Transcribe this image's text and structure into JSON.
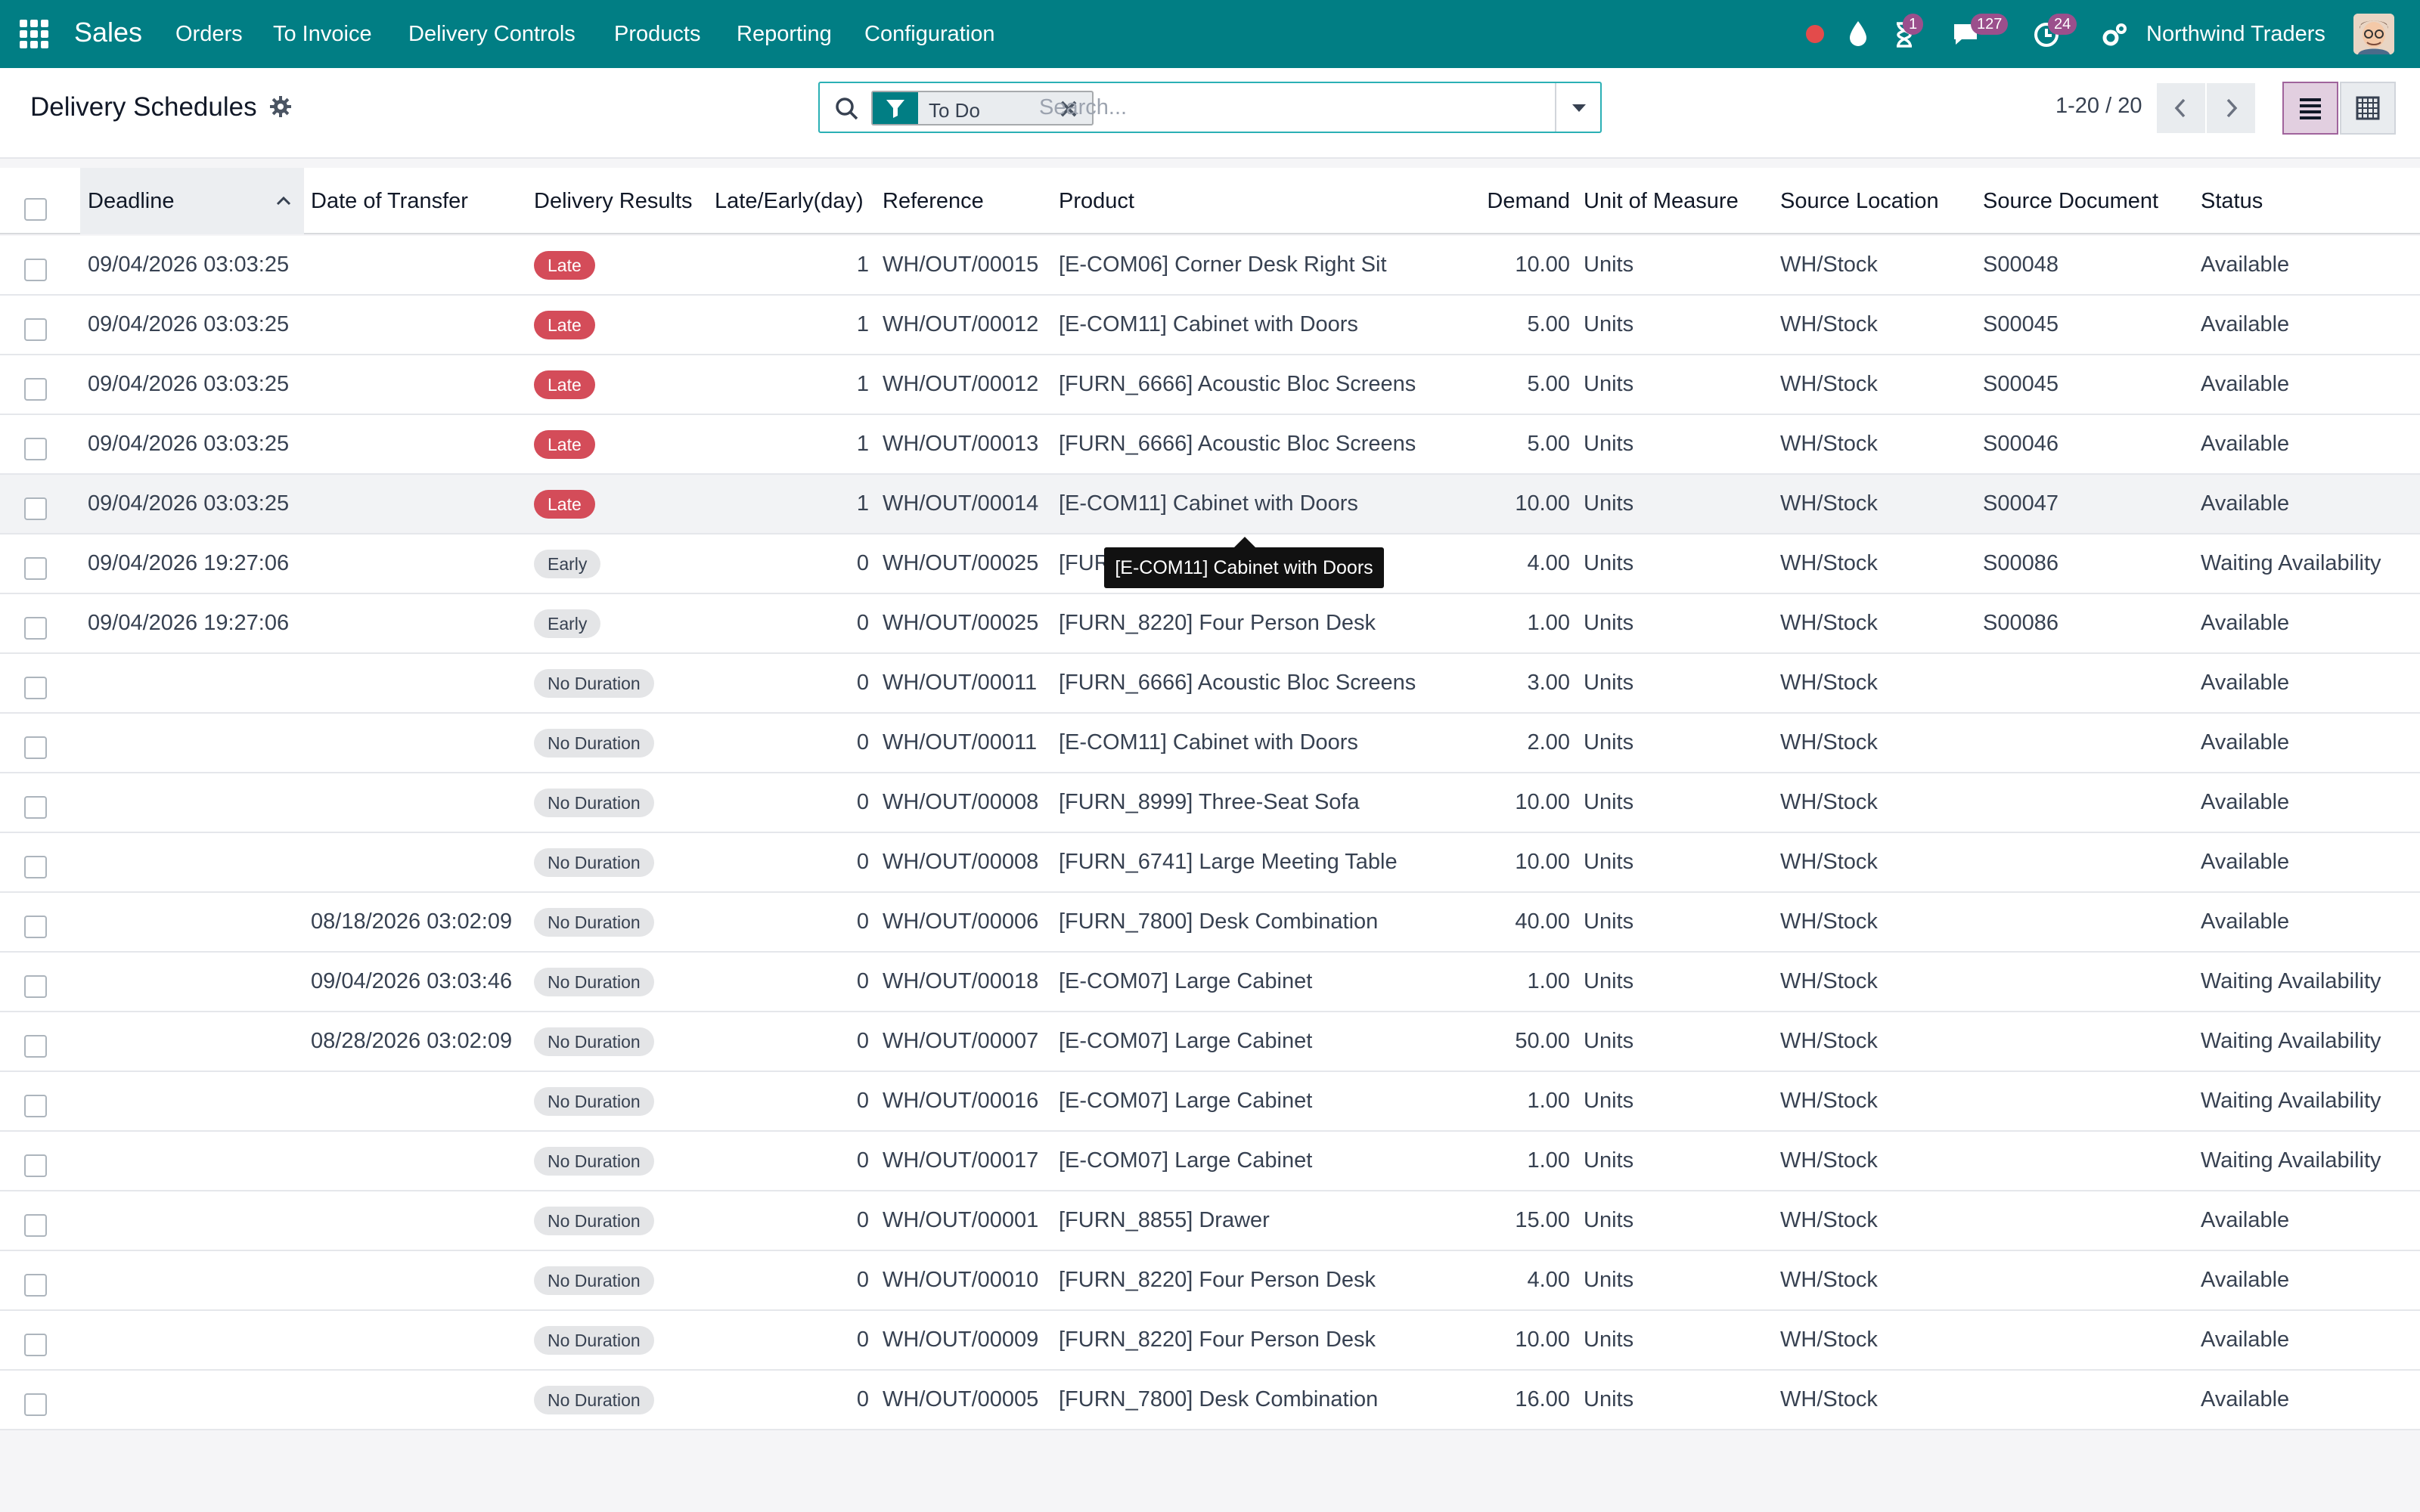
{
  "navbar": {
    "app_name": "Sales",
    "menu": [
      "Orders",
      "To Invoice",
      "Delivery Controls",
      "Products",
      "Reporting",
      "Configuration"
    ],
    "activity_badge": "1",
    "messages_badge": "127",
    "clock_badge": "24",
    "company": "Northwind Traders",
    "colors": {
      "bar": "#017e84",
      "badge": "#9b4f8c",
      "record": "#e34b4b"
    }
  },
  "control_panel": {
    "title": "Delivery Schedules",
    "filter_facet": "To Do",
    "search_placeholder": "Search...",
    "pager": "1-20 / 20"
  },
  "table": {
    "headers": [
      "Deadline",
      "Date of Transfer",
      "Delivery Results",
      "Late/Early(day)",
      "Reference",
      "Product",
      "Demand",
      "Unit of Measure",
      "Source Location",
      "Source Document",
      "Status"
    ],
    "sorted_column": "Deadline",
    "rows": [
      {
        "deadline": "09/04/2026 03:03:25",
        "date_transfer": "",
        "result": "Late",
        "days": "1",
        "ref": "WH/OUT/00015",
        "product": "[E-COM06] Corner Desk Right Sit",
        "demand": "10.00",
        "uom": "Units",
        "src_loc": "WH/Stock",
        "src_doc": "S00048",
        "status": "Available"
      },
      {
        "deadline": "09/04/2026 03:03:25",
        "date_transfer": "",
        "result": "Late",
        "days": "1",
        "ref": "WH/OUT/00012",
        "product": "[E-COM11] Cabinet with Doors",
        "demand": "5.00",
        "uom": "Units",
        "src_loc": "WH/Stock",
        "src_doc": "S00045",
        "status": "Available"
      },
      {
        "deadline": "09/04/2026 03:03:25",
        "date_transfer": "",
        "result": "Late",
        "days": "1",
        "ref": "WH/OUT/00012",
        "product": "[FURN_6666] Acoustic Bloc Screens",
        "demand": "5.00",
        "uom": "Units",
        "src_loc": "WH/Stock",
        "src_doc": "S00045",
        "status": "Available"
      },
      {
        "deadline": "09/04/2026 03:03:25",
        "date_transfer": "",
        "result": "Late",
        "days": "1",
        "ref": "WH/OUT/00013",
        "product": "[FURN_6666] Acoustic Bloc Screens",
        "demand": "5.00",
        "uom": "Units",
        "src_loc": "WH/Stock",
        "src_doc": "S00046",
        "status": "Available"
      },
      {
        "deadline": "09/04/2026 03:03:25",
        "date_transfer": "",
        "result": "Late",
        "days": "1",
        "ref": "WH/OUT/00014",
        "product": "[E-COM11] Cabinet with Doors",
        "demand": "10.00",
        "uom": "Units",
        "src_loc": "WH/Stock",
        "src_doc": "S00047",
        "status": "Available"
      },
      {
        "deadline": "09/04/2026 19:27:06",
        "date_transfer": "",
        "result": "Early",
        "days": "0",
        "ref": "WH/OUT/00025",
        "product": "[FUR",
        "demand": "4.00",
        "uom": "Units",
        "src_loc": "WH/Stock",
        "src_doc": "S00086",
        "status": "Waiting Availability"
      },
      {
        "deadline": "09/04/2026 19:27:06",
        "date_transfer": "",
        "result": "Early",
        "days": "0",
        "ref": "WH/OUT/00025",
        "product": "[FURN_8220] Four Person Desk",
        "demand": "1.00",
        "uom": "Units",
        "src_loc": "WH/Stock",
        "src_doc": "S00086",
        "status": "Available"
      },
      {
        "deadline": "",
        "date_transfer": "",
        "result": "No Duration",
        "days": "0",
        "ref": "WH/OUT/00011",
        "product": "[FURN_6666] Acoustic Bloc Screens",
        "demand": "3.00",
        "uom": "Units",
        "src_loc": "WH/Stock",
        "src_doc": "",
        "status": "Available"
      },
      {
        "deadline": "",
        "date_transfer": "",
        "result": "No Duration",
        "days": "0",
        "ref": "WH/OUT/00011",
        "product": "[E-COM11] Cabinet with Doors",
        "demand": "2.00",
        "uom": "Units",
        "src_loc": "WH/Stock",
        "src_doc": "",
        "status": "Available"
      },
      {
        "deadline": "",
        "date_transfer": "",
        "result": "No Duration",
        "days": "0",
        "ref": "WH/OUT/00008",
        "product": "[FURN_8999] Three-Seat Sofa",
        "demand": "10.00",
        "uom": "Units",
        "src_loc": "WH/Stock",
        "src_doc": "",
        "status": "Available"
      },
      {
        "deadline": "",
        "date_transfer": "",
        "result": "No Duration",
        "days": "0",
        "ref": "WH/OUT/00008",
        "product": "[FURN_6741] Large Meeting Table",
        "demand": "10.00",
        "uom": "Units",
        "src_loc": "WH/Stock",
        "src_doc": "",
        "status": "Available"
      },
      {
        "deadline": "",
        "date_transfer": "08/18/2026 03:02:09",
        "result": "No Duration",
        "days": "0",
        "ref": "WH/OUT/00006",
        "product": "[FURN_7800] Desk Combination",
        "demand": "40.00",
        "uom": "Units",
        "src_loc": "WH/Stock",
        "src_doc": "",
        "status": "Available"
      },
      {
        "deadline": "",
        "date_transfer": "09/04/2026 03:03:46",
        "result": "No Duration",
        "days": "0",
        "ref": "WH/OUT/00018",
        "product": "[E-COM07] Large Cabinet",
        "demand": "1.00",
        "uom": "Units",
        "src_loc": "WH/Stock",
        "src_doc": "",
        "status": "Waiting Availability"
      },
      {
        "deadline": "",
        "date_transfer": "08/28/2026 03:02:09",
        "result": "No Duration",
        "days": "0",
        "ref": "WH/OUT/00007",
        "product": "[E-COM07] Large Cabinet",
        "demand": "50.00",
        "uom": "Units",
        "src_loc": "WH/Stock",
        "src_doc": "",
        "status": "Waiting Availability"
      },
      {
        "deadline": "",
        "date_transfer": "",
        "result": "No Duration",
        "days": "0",
        "ref": "WH/OUT/00016",
        "product": "[E-COM07] Large Cabinet",
        "demand": "1.00",
        "uom": "Units",
        "src_loc": "WH/Stock",
        "src_doc": "",
        "status": "Waiting Availability"
      },
      {
        "deadline": "",
        "date_transfer": "",
        "result": "No Duration",
        "days": "0",
        "ref": "WH/OUT/00017",
        "product": "[E-COM07] Large Cabinet",
        "demand": "1.00",
        "uom": "Units",
        "src_loc": "WH/Stock",
        "src_doc": "",
        "status": "Waiting Availability"
      },
      {
        "deadline": "",
        "date_transfer": "",
        "result": "No Duration",
        "days": "0",
        "ref": "WH/OUT/00001",
        "product": "[FURN_8855] Drawer",
        "demand": "15.00",
        "uom": "Units",
        "src_loc": "WH/Stock",
        "src_doc": "",
        "status": "Available"
      },
      {
        "deadline": "",
        "date_transfer": "",
        "result": "No Duration",
        "days": "0",
        "ref": "WH/OUT/00010",
        "product": "[FURN_8220] Four Person Desk",
        "demand": "4.00",
        "uom": "Units",
        "src_loc": "WH/Stock",
        "src_doc": "",
        "status": "Available"
      },
      {
        "deadline": "",
        "date_transfer": "",
        "result": "No Duration",
        "days": "0",
        "ref": "WH/OUT/00009",
        "product": "[FURN_8220] Four Person Desk",
        "demand": "10.00",
        "uom": "Units",
        "src_loc": "WH/Stock",
        "src_doc": "",
        "status": "Available"
      },
      {
        "deadline": "",
        "date_transfer": "",
        "result": "No Duration",
        "days": "0",
        "ref": "WH/OUT/00005",
        "product": "[FURN_7800] Desk Combination",
        "demand": "16.00",
        "uom": "Units",
        "src_loc": "WH/Stock",
        "src_doc": "",
        "status": "Available"
      }
    ],
    "hovered_row": 4,
    "result_colors": {
      "Late": "#d44c59",
      "Early": "#e4e5e7",
      "No Duration": "#e4e5e7"
    }
  },
  "tooltip": {
    "text": "[E-COM11] Cabinet with Doors"
  }
}
